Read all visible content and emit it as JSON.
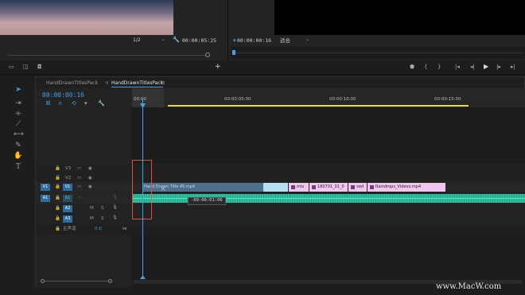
{
  "source_monitor": {
    "zoom": "1/2",
    "timecode": "00:00:05:25"
  },
  "program_monitor": {
    "timecode": "00:00:00:16",
    "fit": "适合"
  },
  "tabs": {
    "tab1": "HandDrawnTitlesPack",
    "tab2": "HandDrawnTitlesPack"
  },
  "timeline": {
    "timecode": "00:00:00:16",
    "ruler": [
      "00:00",
      "00:00:05:00",
      "00:00:10:00",
      "00:00:15:00"
    ],
    "tracks": {
      "v3": "V3",
      "v2": "V2",
      "v1_src": "V1",
      "v1": "V1",
      "a1_src": "A1",
      "a1": "A1",
      "a2": "A2",
      "a3": "A3",
      "master": "主声道",
      "master_val": "0.0",
      "m": "M",
      "s": "S"
    },
    "clips": {
      "clip_a": "Hand Drawn Title 45.mp4",
      "clip_b": "mix",
      "clip_c": "180701_01_0",
      "clip_d": "ved",
      "clip_e": "Raindrops_Videvo.mp4"
    },
    "drag_offset": "-00:00:01:06"
  },
  "watermark": "www.MacW.com",
  "colors": {
    "accent": "#4a9ee8",
    "audio": "#2fbf9f",
    "clip_pink": "#f1c7ef",
    "clip_blue": "#4f6f8f",
    "highlight_red": "#e74c3c"
  }
}
